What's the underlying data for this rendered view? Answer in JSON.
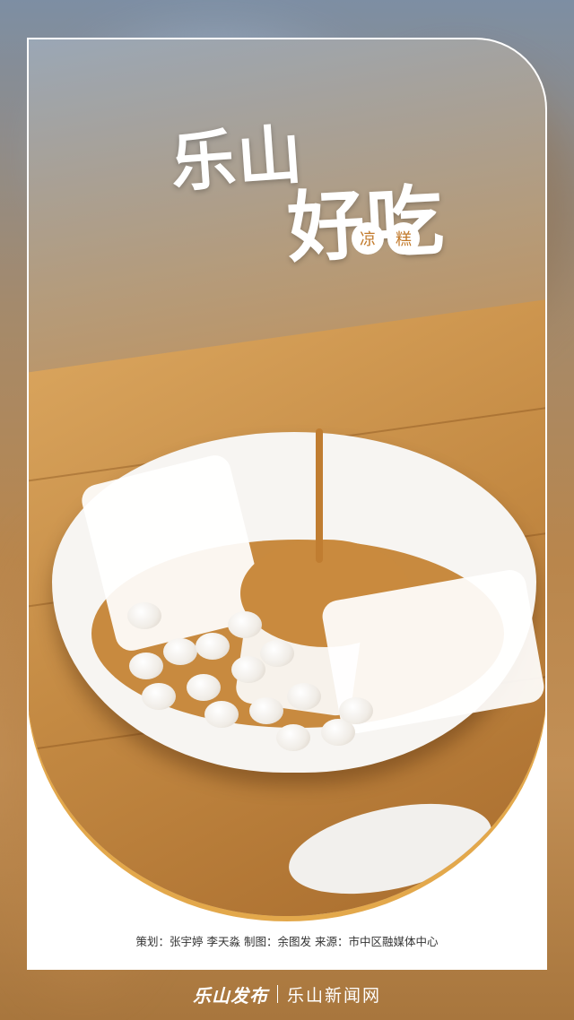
{
  "title": {
    "line1": "乐山",
    "line2": "好吃",
    "subtitle": [
      "凉",
      "糕"
    ]
  },
  "credits": {
    "text": "策划：张宇婷 李天淼  制图：余图发  来源：市中区融媒体中心"
  },
  "footer": {
    "logo_primary": "乐山发布",
    "logo_secondary": "乐山新闻网"
  },
  "colors": {
    "accent": "#e3a84b",
    "subtitle_text": "#c27a2b",
    "frame": "#ffffff"
  }
}
